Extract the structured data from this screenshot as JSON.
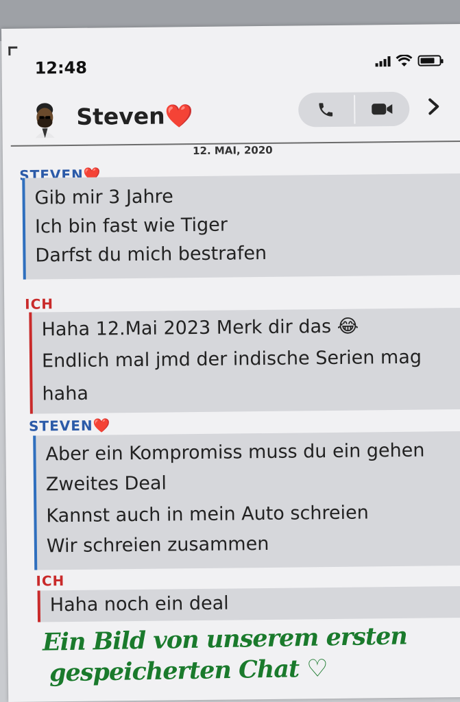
{
  "status_bar": {
    "time": "12:48"
  },
  "header": {
    "contact_name": "Steven",
    "heart": "❤️",
    "icons": [
      "avatar-emoji",
      "phone-icon",
      "video-icon",
      "chevron-right-icon"
    ]
  },
  "date_label": "12. MAI, 2020",
  "messages": [
    {
      "sender": "STEVEN",
      "heart": "❤️",
      "lines": [
        "Gib mir 3 Jahre",
        "Ich bin fast wie Tiger",
        "Darfst du mich bestrafen"
      ]
    },
    {
      "sender": "ICH",
      "lines": [
        "Haha 12.Mai 2023 Merk dir das 😂",
        "Endlich mal jmd der indische Serien mag",
        "haha"
      ]
    },
    {
      "sender": "STEVEN",
      "heart": "❤️",
      "lines": [
        "Aber ein Kompromiss muss du ein gehen",
        "Zweites Deal",
        "Kannst auch in mein Auto schreien",
        "Wir schreien zusammen"
      ]
    },
    {
      "sender": "ICH",
      "lines": [
        "Haha noch ein deal"
      ]
    }
  ],
  "handwriting": {
    "line1": "Ein Bild von unserem ersten",
    "line2": "gespeicherten Chat ♡"
  },
  "colors": {
    "steven": "#2b5aa8",
    "me": "#c92a2a",
    "handwriting": "#1a7a2c"
  }
}
